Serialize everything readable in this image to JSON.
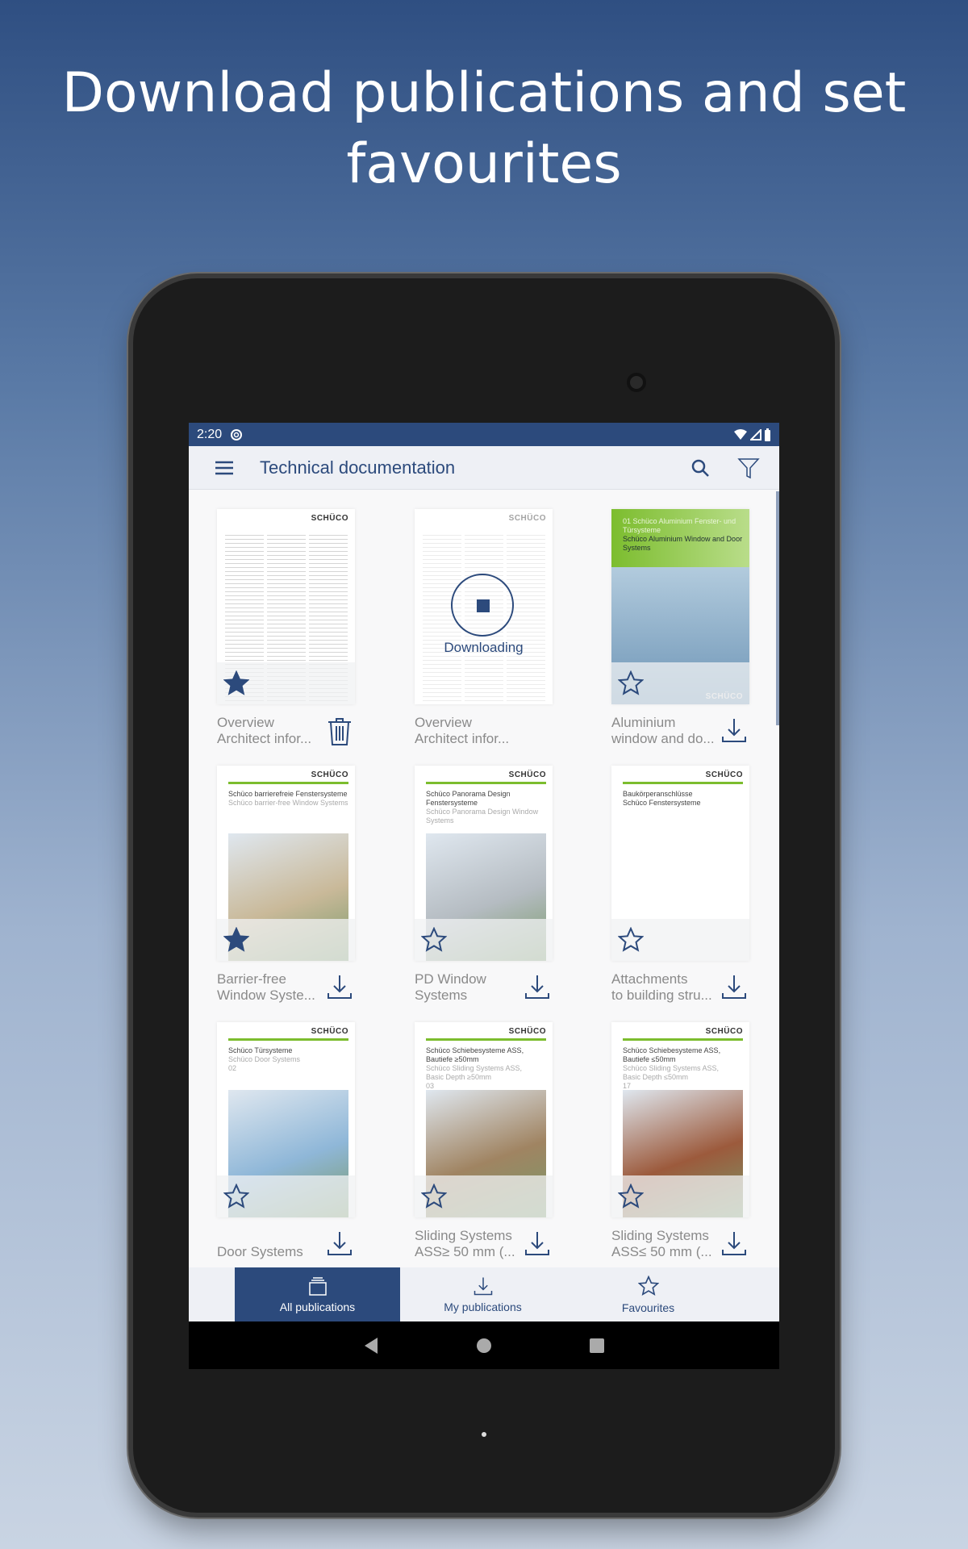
{
  "headline": [
    "Download publications and set",
    "favourites"
  ],
  "status": {
    "time": "2:20"
  },
  "appbar": {
    "title": "Technical documentation",
    "icons": [
      "menu-icon",
      "search-icon",
      "filter-icon"
    ]
  },
  "colors": {
    "primary": "#2c4a7c",
    "green": "#7cbd2e"
  },
  "downloading_label": "Downloading",
  "cards": [
    {
      "title": [
        "Overview",
        "Architect infor..."
      ],
      "favourite": true,
      "action": "delete",
      "cover": {
        "logo": "SCHÜCO",
        "type": "overview"
      }
    },
    {
      "title": [
        "Overview",
        "Architect infor..."
      ],
      "favourite": false,
      "action": "downloading",
      "cover": {
        "logo": "SCHÜCO",
        "type": "overview"
      }
    },
    {
      "title": [
        "Aluminium",
        "window and do..."
      ],
      "favourite": false,
      "action": "download",
      "cover": {
        "logo": "SCHÜCO",
        "type": "green",
        "lines": [
          "01 Schüco Aluminium Fenster- und Türsysteme"
        ],
        "sub": [
          "Schüco Aluminium Window and Door Systems"
        ]
      }
    },
    {
      "title": [
        "Barrier-free",
        "Window Syste..."
      ],
      "favourite": true,
      "action": "download",
      "cover": {
        "logo": "SCHÜCO",
        "type": "photo",
        "lines": [
          "Schüco barrierefreie Fenstersysteme"
        ],
        "sub": [
          "Schüco barrier-free Window Systems"
        ],
        "img": "#c9b999"
      }
    },
    {
      "title": [
        "PD Window",
        "Systems"
      ],
      "favourite": false,
      "action": "download",
      "cover": {
        "logo": "SCHÜCO",
        "type": "photo",
        "lines": [
          "Schüco Panorama Design Fenstersysteme"
        ],
        "sub": [
          "Schüco Panorama Design Window Systems"
        ],
        "img": "#b5bcc2"
      }
    },
    {
      "title": [
        "Attachments",
        "to building stru..."
      ],
      "favourite": false,
      "action": "download",
      "cover": {
        "logo": "SCHÜCO",
        "type": "blank",
        "lines": [
          "Baukörperanschlüsse",
          "Schüco Fenstersysteme"
        ],
        "sub": []
      }
    },
    {
      "title": [
        "Door Systems",
        ""
      ],
      "favourite": false,
      "action": "download",
      "cover": {
        "logo": "SCHÜCO",
        "type": "photo",
        "lines": [
          "Schüco Türsysteme"
        ],
        "sub": [
          "Schüco Door Systems",
          "02"
        ],
        "img": "#8fb7d8"
      }
    },
    {
      "title": [
        "Sliding Systems",
        "ASS≥ 50 mm (..."
      ],
      "favourite": false,
      "action": "download",
      "cover": {
        "logo": "SCHÜCO",
        "type": "photo",
        "lines": [
          "Schüco Schiebesysteme ASS,",
          "Bautiefe ≥50mm"
        ],
        "sub": [
          "Schüco Sliding Systems ASS,",
          "Basic Depth ≥50mm",
          "03"
        ],
        "img": "#a08462"
      }
    },
    {
      "title": [
        "Sliding Systems",
        "ASS≤ 50 mm (..."
      ],
      "favourite": false,
      "action": "download",
      "cover": {
        "logo": "SCHÜCO",
        "type": "photo",
        "lines": [
          "Schüco Schiebesysteme ASS,",
          "Bautiefe ≤50mm"
        ],
        "sub": [
          "Schüco Sliding Systems ASS,",
          "Basic Depth ≤50mm",
          "17"
        ],
        "img": "#9c5a3c"
      }
    }
  ],
  "bottom_nav": [
    {
      "label": "All publications",
      "icon": "stack-icon",
      "active": true
    },
    {
      "label": "My publications",
      "icon": "download-icon",
      "active": false
    },
    {
      "label": "Favourites",
      "icon": "star-icon",
      "active": false
    }
  ]
}
